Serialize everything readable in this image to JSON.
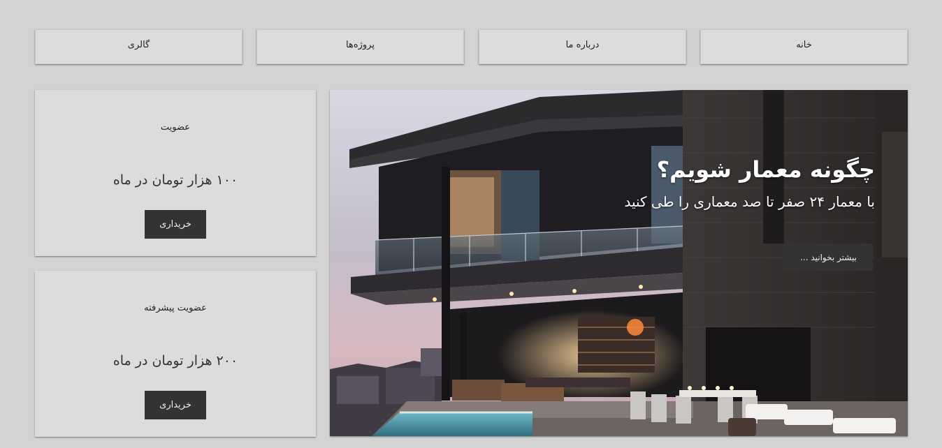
{
  "nav": {
    "items": [
      {
        "label": "خانه"
      },
      {
        "label": "درباره ما"
      },
      {
        "label": "پروژه‌ها"
      },
      {
        "label": "گالری"
      }
    ]
  },
  "plans": [
    {
      "title": "عضویت",
      "price": "۱۰۰ هزار تومان در ماه",
      "button": "خریداری"
    },
    {
      "title": "عضویت پیشرفته",
      "price": "۲۰۰ هزار تومان در ماه",
      "button": "خریداری"
    }
  ],
  "hero": {
    "title": "چگونه معمار شویم؟",
    "subtitle": "با معمار ۲۴ صفر تا صد معماری را طی کنید",
    "button": "بیشتر بخوانید ..."
  },
  "colors": {
    "page_bg": "#d3d3d3",
    "card_bg": "#dcdcdc",
    "button_bg": "#333333"
  }
}
